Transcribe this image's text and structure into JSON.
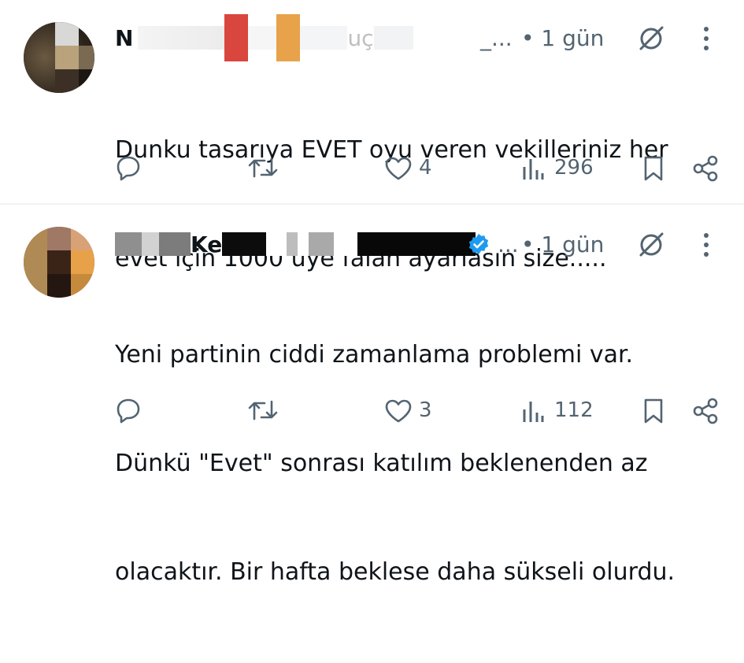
{
  "tweets": [
    {
      "author_visible": "N",
      "author_visible_2": "uç",
      "author_ellipsis": "_...",
      "time": "• 1 gün",
      "text_lines": [
        "Dunku tasarıya EVET oyu veren vekilleriniz her",
        "evet için 1000 üye falan ayarlasın size....."
      ],
      "likes": "4",
      "views": "296",
      "verified": false
    },
    {
      "author_visible": "Ke",
      "author_ellipsis": "...",
      "time": "• 1 gün",
      "text_lines": [
        "Yeni partinin ciddi zamanlama problemi var.",
        "Dünkü \"Evet\" sonrası katılım beklenenden az",
        "olacaktır. Bir hafta beklese daha sükseli olurdu."
      ],
      "likes": "3",
      "views": "112",
      "verified": true
    }
  ],
  "icons": {
    "reply": "reply-icon",
    "retweet": "retweet-icon",
    "like": "heart-icon",
    "views": "views-icon",
    "bookmark": "bookmark-icon",
    "share": "share-icon",
    "grok": "grok-icon",
    "more": "more-icon"
  },
  "colors": {
    "verified": "#1d9bf0",
    "muted": "#536471",
    "text": "#0f1419"
  }
}
